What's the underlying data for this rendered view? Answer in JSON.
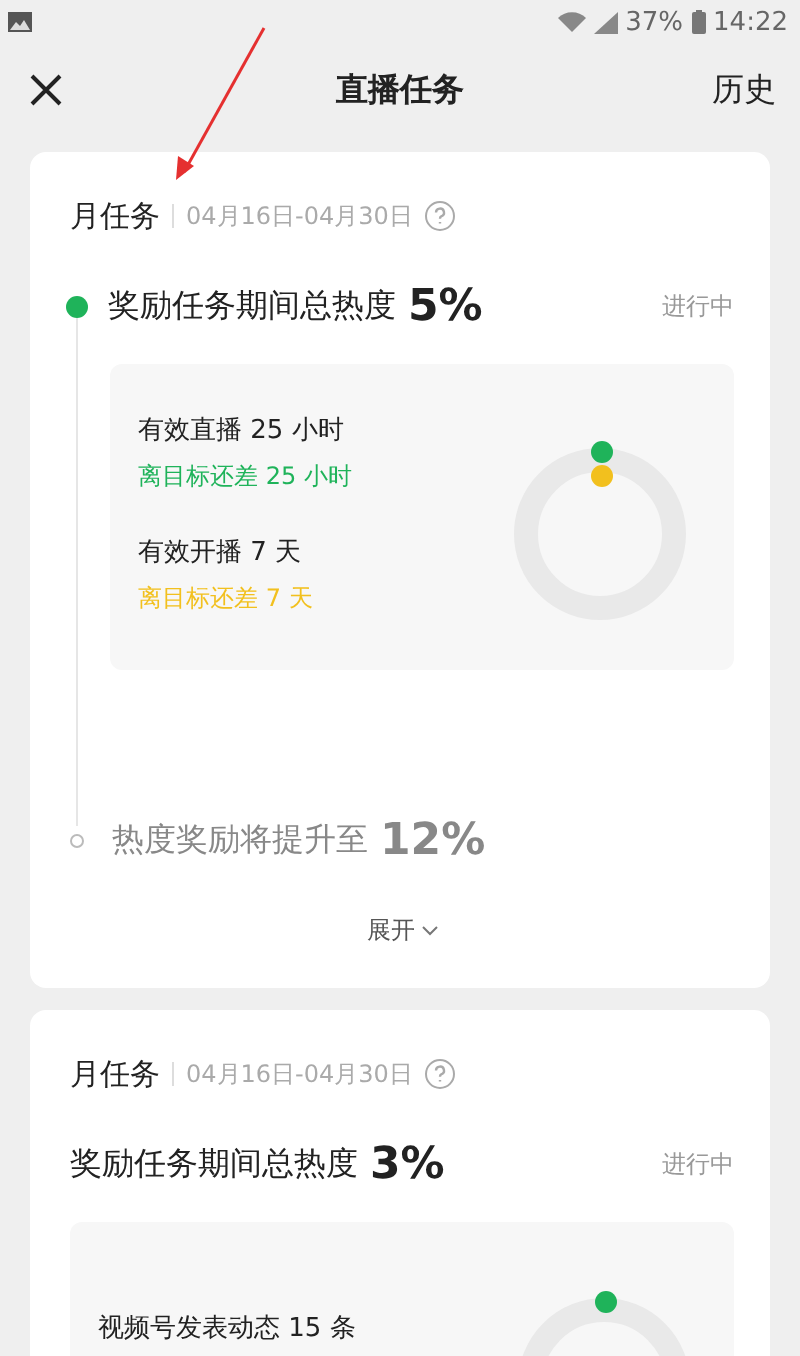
{
  "status_bar": {
    "battery": "37%",
    "time": "14:22"
  },
  "header": {
    "title": "直播任务",
    "action": "历史"
  },
  "tasks": [
    {
      "kind": "timeline",
      "period": "月任务",
      "date_range": "04月16日-04月30日",
      "milestones": [
        {
          "reached": true,
          "text": "奖励任务期间总热度",
          "value": "5%",
          "status": "进行中",
          "goals": [
            {
              "text": "有效直播 25 小时",
              "remaining": "离目标还差 25 小时",
              "color": "#1fb35a"
            },
            {
              "text": "有效开播 7 天",
              "remaining": "离目标还差 7 天",
              "color": "#f2c01e"
            }
          ]
        },
        {
          "reached": false,
          "text": "热度奖励将提升至",
          "value": "12%"
        }
      ],
      "expand_label": "展开"
    },
    {
      "kind": "plain",
      "period": "月任务",
      "date_range": "04月16日-04月30日",
      "milestones": [
        {
          "text": "奖励任务期间总热度",
          "value": "3%",
          "status": "进行中",
          "goals": [
            {
              "text": "视频号发表动态 15 条",
              "color": "#1fb35a"
            }
          ]
        }
      ]
    }
  ]
}
